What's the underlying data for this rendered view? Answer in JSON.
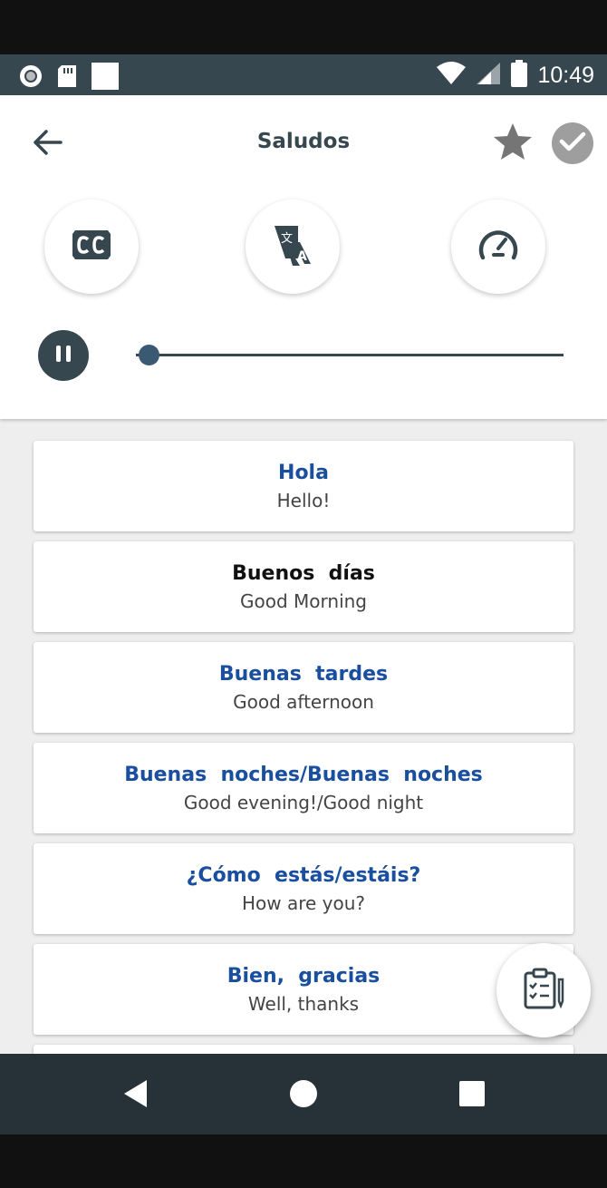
{
  "status_bar": {
    "time": "10:49",
    "icons": [
      "record-icon",
      "sd-card-icon",
      "square-icon",
      "wifi-icon",
      "signal-icon",
      "battery-icon"
    ]
  },
  "header": {
    "title": "Saludos",
    "icons": {
      "back": "arrow-left-icon",
      "favorite": "star-icon",
      "complete": "check-icon",
      "captions": "cc-icon",
      "translate": "translate-icon",
      "speed": "speedometer-icon"
    }
  },
  "player": {
    "state_icon": "pause-icon",
    "progress": 0.03
  },
  "phrases": [
    {
      "phrase": "Hola",
      "translation": "Hello!",
      "highlighted": false
    },
    {
      "phrase": "Buenos  días",
      "translation": "Good Morning",
      "highlighted": true
    },
    {
      "phrase": "Buenas  tardes",
      "translation": "Good afternoon",
      "highlighted": false
    },
    {
      "phrase": "Buenas  noches/Buenas  noches",
      "translation": "Good evening!/Good night",
      "highlighted": false
    },
    {
      "phrase": "¿Cómo  estás/estáis?",
      "translation": "How are you?",
      "highlighted": false
    },
    {
      "phrase": "Bien,  gracias",
      "translation": "Well, thanks",
      "highlighted": false
    }
  ],
  "fab": {
    "icon": "quiz-clipboard-icon"
  },
  "nav_bar": {
    "icons": [
      "back-triangle-icon",
      "home-circle-icon",
      "recents-square-icon"
    ]
  },
  "colors": {
    "accent": "#1a4fa0",
    "dark": "#37474f",
    "status_bar": "#37474f",
    "nav_bar": "#263238"
  }
}
